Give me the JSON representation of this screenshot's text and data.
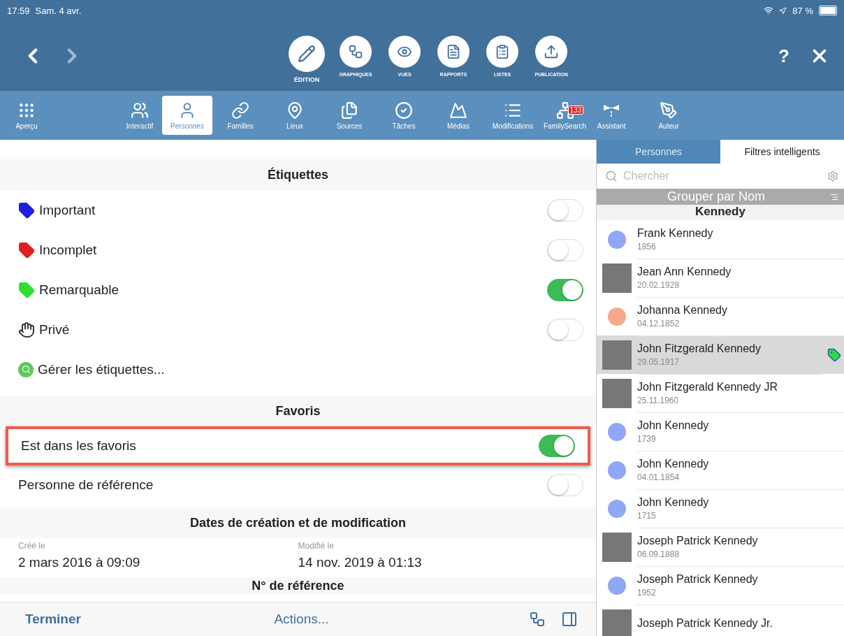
{
  "status_bar": {
    "time": "17:59",
    "date": "Sam. 4 avr.",
    "battery": "87 %"
  },
  "main_toolbar": {
    "items": [
      {
        "kind": "edit",
        "label": "ÉDITION",
        "selected": true
      },
      {
        "kind": "charts",
        "label": "GRAPHIQUES",
        "selected": false
      },
      {
        "kind": "views",
        "label": "VUES",
        "selected": false
      },
      {
        "kind": "reports",
        "label": "RAPPORTS",
        "selected": false
      },
      {
        "kind": "lists",
        "label": "LISTES",
        "selected": false
      },
      {
        "kind": "publish",
        "label": "PUBLICATION",
        "selected": false
      }
    ],
    "help": "?"
  },
  "sub_toolbar": {
    "items": [
      {
        "kind": "overview",
        "label": "Aperçu",
        "selected": false
      },
      {
        "kind": "interactive",
        "label": "Interactif",
        "selected": false
      },
      {
        "kind": "persons",
        "label": "Personnes",
        "selected": true
      },
      {
        "kind": "families",
        "label": "Familles",
        "selected": false
      },
      {
        "kind": "places",
        "label": "Lieux",
        "selected": false
      },
      {
        "kind": "sources",
        "label": "Sources",
        "selected": false
      },
      {
        "kind": "tasks",
        "label": "Tâches",
        "selected": false
      },
      {
        "kind": "media",
        "label": "Médias",
        "selected": false
      },
      {
        "kind": "changes",
        "label": "Modifications",
        "selected": false
      },
      {
        "kind": "familysearch",
        "label": "FamilySearch",
        "selected": false,
        "badge": "133"
      },
      {
        "kind": "assistant",
        "label": "Assistant",
        "selected": false
      },
      {
        "kind": "author",
        "label": "Auteur",
        "selected": false
      }
    ]
  },
  "detail": {
    "sections": [
      {
        "title": "Étiquettes",
        "rows": [
          {
            "kind": "tag",
            "label": "Important",
            "color": "#1f1fe0",
            "on": false
          },
          {
            "kind": "tag",
            "label": "Incomplet",
            "color": "#e01f1f",
            "on": false
          },
          {
            "kind": "tag",
            "label": "Remarquable",
            "color": "#2ee02e",
            "on": true
          },
          {
            "kind": "private",
            "label": "Privé",
            "on": false
          },
          {
            "kind": "manage",
            "label": "Gérer les étiquettes..."
          }
        ]
      },
      {
        "title": "Favoris",
        "rows": [
          {
            "kind": "toggle",
            "label": "Est dans les favoris",
            "on": true,
            "highlighted": true
          },
          {
            "kind": "toggle",
            "label": "Personne de référence",
            "on": false,
            "highlighted": false
          }
        ]
      },
      {
        "title": "Dates de création et de modification",
        "fields": [
          {
            "label": "Créé le",
            "value": "2 mars 2016 à 09:09"
          },
          {
            "label": "Modifié le",
            "value": "14 nov. 2019 à 01:13"
          }
        ]
      },
      {
        "title": "N° de référence"
      }
    ]
  },
  "bottom_bar": {
    "done": "Terminer",
    "actions": "Actions..."
  },
  "people_panel": {
    "tabs": [
      {
        "label": "Personnes",
        "selected": true
      },
      {
        "label": "Filtres intelligents",
        "selected": false
      }
    ],
    "search": {
      "placeholder": "Chercher"
    },
    "group_by": "Grouper par Nom",
    "section": "Kennedy",
    "people": [
      {
        "name": "Frank Kennedy",
        "date": "1856",
        "kind": "dot",
        "color": "#8fa8f5",
        "selected": false,
        "tagged": false
      },
      {
        "name": "Jean Ann Kennedy",
        "date": "20.02.1928",
        "kind": "photo",
        "selected": false,
        "tagged": false
      },
      {
        "name": "Johanna Kennedy",
        "date": "04.12.1852",
        "kind": "dot",
        "color": "#f7a88c",
        "selected": false,
        "tagged": false
      },
      {
        "name": "John Fitzgerald Kennedy",
        "date": "29.05.1917",
        "kind": "photo",
        "selected": true,
        "tagged": true
      },
      {
        "name": "John Fitzgerald Kennedy JR",
        "date": "25.11.1960",
        "kind": "photo",
        "selected": false,
        "tagged": false
      },
      {
        "name": "John Kennedy",
        "date": "1739",
        "kind": "dot",
        "color": "#8fa8f5",
        "selected": false,
        "tagged": false
      },
      {
        "name": "John Kennedy",
        "date": "04.01.1854",
        "kind": "dot",
        "color": "#8fa8f5",
        "selected": false,
        "tagged": false
      },
      {
        "name": "John Kennedy",
        "date": "1715",
        "kind": "dot",
        "color": "#8fa8f5",
        "selected": false,
        "tagged": false
      },
      {
        "name": "Joseph Patrick Kennedy",
        "date": "06.09.1888",
        "kind": "photo",
        "selected": false,
        "tagged": false
      },
      {
        "name": "Joseph Patrick Kennedy",
        "date": "1952",
        "kind": "dot",
        "color": "#8fa8f5",
        "selected": false,
        "tagged": false
      },
      {
        "name": "Joseph Patrick Kennedy Jr.",
        "kind": "photo",
        "selected": false,
        "tagged": false
      }
    ]
  }
}
